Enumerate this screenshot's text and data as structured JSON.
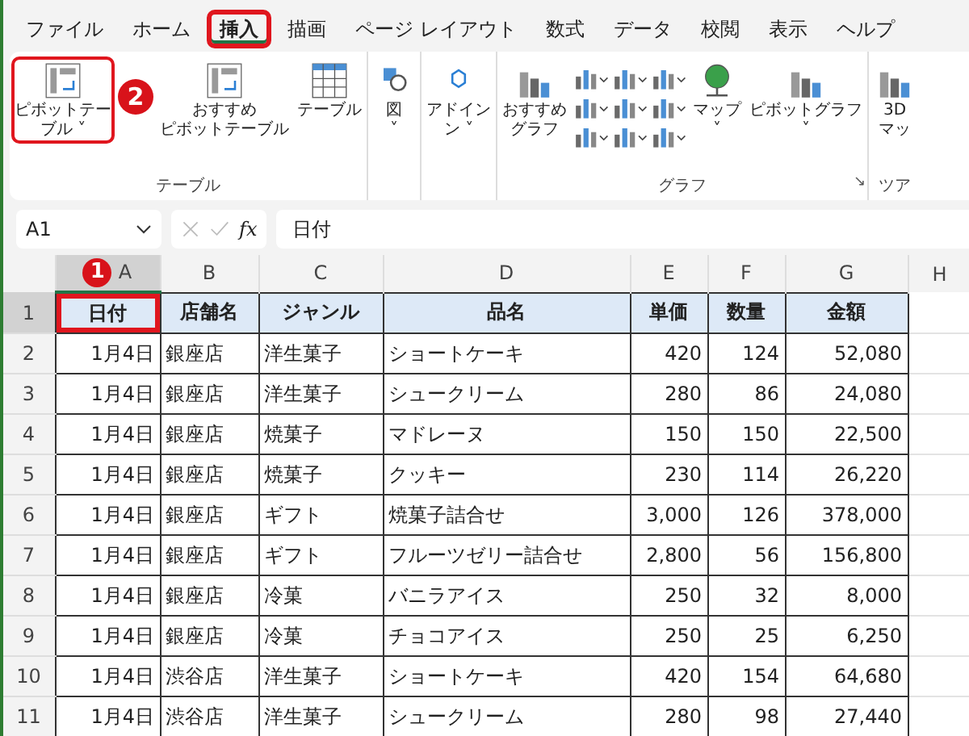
{
  "menu_tabs": [
    {
      "label": "ファイル",
      "selected": false,
      "highlighted": false
    },
    {
      "label": "ホーム",
      "selected": false,
      "highlighted": false
    },
    {
      "label": "挿入",
      "selected": true,
      "highlighted": true
    },
    {
      "label": "描画",
      "selected": false,
      "highlighted": false
    },
    {
      "label": "ページ レイアウト",
      "selected": false,
      "highlighted": false
    },
    {
      "label": "数式",
      "selected": false,
      "highlighted": false
    },
    {
      "label": "データ",
      "selected": false,
      "highlighted": false
    },
    {
      "label": "校閲",
      "selected": false,
      "highlighted": false
    },
    {
      "label": "表示",
      "selected": false,
      "highlighted": false
    },
    {
      "label": "ヘルプ",
      "selected": false,
      "highlighted": false
    }
  ],
  "ribbon_groups": [
    {
      "label": "テーブル",
      "items": [
        {
          "kind": "pivot",
          "lines": [
            "ピボットテー",
            "ブル ˅"
          ],
          "highlighted": true,
          "callout": "2"
        },
        {
          "kind": "recpivot",
          "lines": [
            "おすすめ",
            "ピボットテーブル"
          ],
          "highlighted": false
        },
        {
          "kind": "table",
          "lines": [
            "テーブル"
          ],
          "highlighted": false
        }
      ]
    },
    {
      "items": [
        {
          "kind": "shapes",
          "lines": [
            "図",
            "˅"
          ],
          "highlighted": false
        }
      ]
    },
    {
      "items": [
        {
          "kind": "addin",
          "lines": [
            "アドイン",
            "ン ˅"
          ],
          "highlighted": false
        }
      ]
    },
    {
      "label": "グラフ",
      "launcher": "↘",
      "items": [
        {
          "kind": "recchart",
          "lines": [
            "おすすめ",
            "グラフ"
          ],
          "highlighted": false
        },
        {
          "kind": "minis"
        },
        {
          "kind": "map",
          "lines": [
            "マップ",
            "˅"
          ],
          "highlighted": false
        },
        {
          "kind": "pivotchart",
          "lines": [
            "ピボットグラフ",
            "˅"
          ],
          "highlighted": false
        }
      ]
    },
    {
      "label": "ツア",
      "items": [
        {
          "kind": "map3d",
          "lines": [
            "3D",
            "マッ"
          ],
          "highlighted": false
        }
      ]
    }
  ],
  "formula_bar": {
    "name_box": "A1",
    "fx": "fx",
    "value": "日付"
  },
  "sheet": {
    "column_letters": [
      {
        "label": "A",
        "selected": true
      },
      {
        "label": "B",
        "selected": false
      },
      {
        "label": "C",
        "selected": false
      },
      {
        "label": "D",
        "selected": false
      },
      {
        "label": "E",
        "selected": false
      },
      {
        "label": "F",
        "selected": false
      },
      {
        "label": "G",
        "selected": false
      },
      {
        "label": "H",
        "selected": false
      }
    ],
    "header": {
      "row_number": "1",
      "selected": true,
      "cells": [
        {
          "text": "日付",
          "highlighted": true,
          "callout": "1"
        },
        {
          "text": "店舗名",
          "highlighted": false
        },
        {
          "text": "ジャンル",
          "highlighted": false
        },
        {
          "text": "品名",
          "highlighted": false
        },
        {
          "text": "単価",
          "highlighted": false
        },
        {
          "text": "数量",
          "highlighted": false
        },
        {
          "text": "金額",
          "highlighted": false
        }
      ]
    },
    "rows": [
      {
        "n": "2",
        "cells": [
          "1月4日",
          "銀座店",
          "洋生菓子",
          "ショートケーキ",
          "420",
          "124",
          "52,080"
        ]
      },
      {
        "n": "3",
        "cells": [
          "1月4日",
          "銀座店",
          "洋生菓子",
          "シュークリーム",
          "280",
          "86",
          "24,080"
        ]
      },
      {
        "n": "4",
        "cells": [
          "1月4日",
          "銀座店",
          "焼菓子",
          "マドレーヌ",
          "150",
          "150",
          "22,500"
        ]
      },
      {
        "n": "5",
        "cells": [
          "1月4日",
          "銀座店",
          "焼菓子",
          "クッキー",
          "230",
          "114",
          "26,220"
        ]
      },
      {
        "n": "6",
        "cells": [
          "1月4日",
          "銀座店",
          "ギフト",
          "焼菓子詰合せ",
          "3,000",
          "126",
          "378,000"
        ]
      },
      {
        "n": "7",
        "cells": [
          "1月4日",
          "銀座店",
          "ギフト",
          "フルーツゼリー詰合せ",
          "2,800",
          "56",
          "156,800"
        ]
      },
      {
        "n": "8",
        "cells": [
          "1月4日",
          "銀座店",
          "冷菓",
          "バニラアイス",
          "250",
          "32",
          "8,000"
        ]
      },
      {
        "n": "9",
        "cells": [
          "1月4日",
          "銀座店",
          "冷菓",
          "チョコアイス",
          "250",
          "25",
          "6,250"
        ]
      },
      {
        "n": "10",
        "cells": [
          "1月4日",
          "渋谷店",
          "洋生菓子",
          "ショートケーキ",
          "420",
          "154",
          "64,680"
        ]
      },
      {
        "n": "11",
        "cells": [
          "1月4日",
          "渋谷店",
          "洋生菓子",
          "シュークリーム",
          "280",
          "98",
          "27,440"
        ]
      }
    ]
  }
}
